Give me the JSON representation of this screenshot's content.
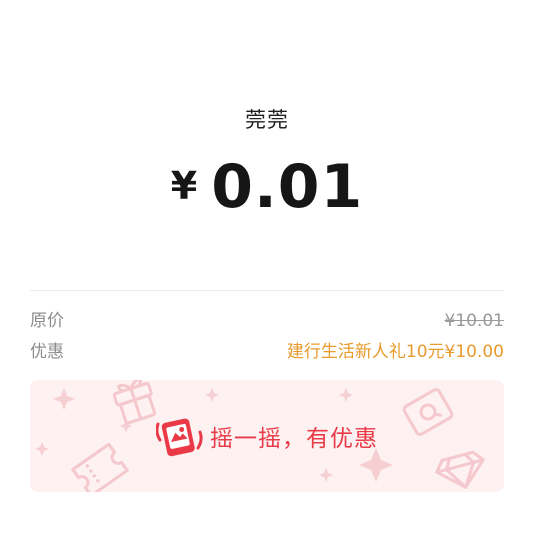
{
  "payment": {
    "merchant_name": "莞莞",
    "currency_symbol": "¥",
    "amount": "0.01"
  },
  "details": {
    "original_price_label": "原价",
    "original_price_value": "¥10.01",
    "discount_label": "优惠",
    "discount_value": "建行生活新人礼10元¥10.00"
  },
  "shake_banner": {
    "text": "摇一摇，有优惠"
  },
  "colors": {
    "discount": "#e89a2c",
    "shake_text": "#ea3a48",
    "banner_bg": "#fdf1f1"
  },
  "icons": [
    "gift-icon",
    "sparkle-icon",
    "coupon-icon",
    "ticket-icon",
    "diamond-icon",
    "shake-phone-icon"
  ]
}
